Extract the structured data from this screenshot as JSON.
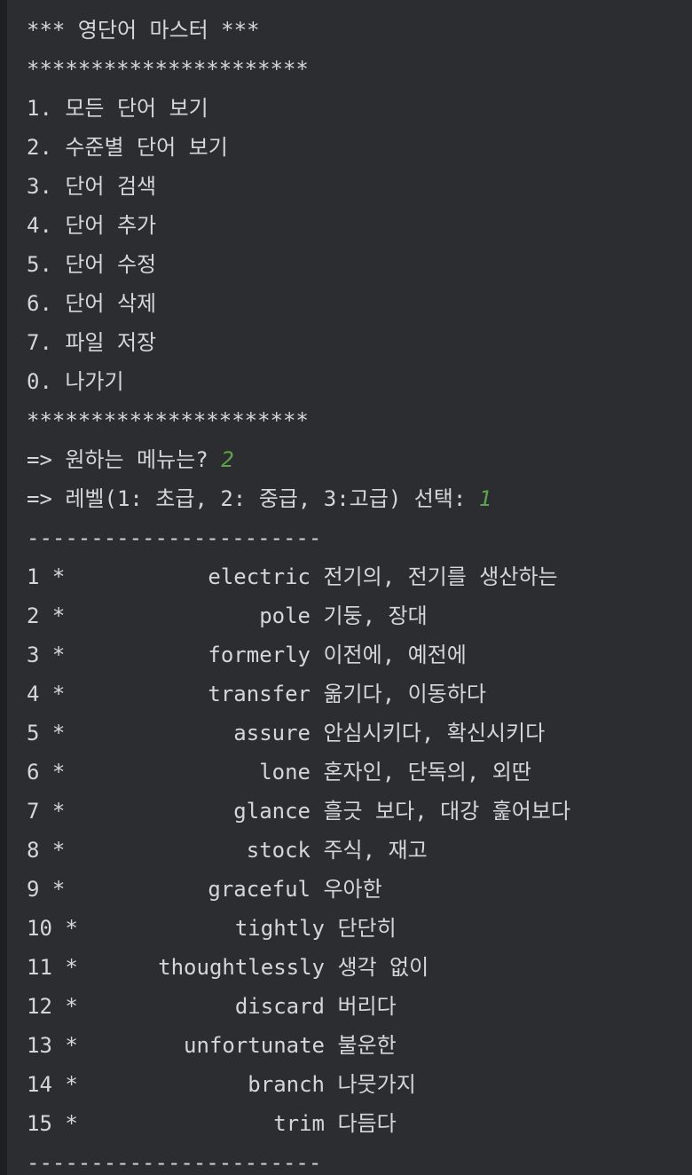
{
  "console": {
    "title": "*** 영단어 마스터 ***",
    "separator_stars": "**********************",
    "menu": [
      "1. 모든 단어 보기",
      "2. 수준별 단어 보기",
      "3. 단어 검색",
      "4. 단어 추가",
      "5. 단어 수정",
      "6. 단어 삭제",
      "7. 파일 저장",
      "0. 나가기"
    ],
    "prompt_menu": "=> 원하는 메뉴는? ",
    "input_menu": "2",
    "prompt_level": "=> 레벨(1: 초급, 2: 중급, 3:고급) 선택: ",
    "input_level": "1",
    "separator_dashes": "-----------------------",
    "words": [
      {
        "num": "1 *",
        "word": "electric",
        "meaning": "전기의, 전기를 생산하는"
      },
      {
        "num": "2 *",
        "word": "pole",
        "meaning": "기둥, 장대"
      },
      {
        "num": "3 *",
        "word": "formerly",
        "meaning": "이전에, 예전에"
      },
      {
        "num": "4 *",
        "word": "transfer",
        "meaning": "옮기다, 이동하다"
      },
      {
        "num": "5 *",
        "word": "assure",
        "meaning": "안심시키다, 확신시키다"
      },
      {
        "num": "6 *",
        "word": "lone",
        "meaning": "혼자인, 단독의, 외딴"
      },
      {
        "num": "7 *",
        "word": "glance",
        "meaning": "흘긋 보다, 대강 훑어보다"
      },
      {
        "num": "8 *",
        "word": "stock",
        "meaning": "주식, 재고"
      },
      {
        "num": "9 *",
        "word": "graceful",
        "meaning": "우아한"
      },
      {
        "num": "10 *",
        "word": "tightly",
        "meaning": "단단히"
      },
      {
        "num": "11 *",
        "word": "thoughtlessly",
        "meaning": "생각 없이"
      },
      {
        "num": "12 *",
        "word": "discard",
        "meaning": "버리다"
      },
      {
        "num": "13 *",
        "word": "unfortunate",
        "meaning": "불운한"
      },
      {
        "num": "14 *",
        "word": "branch",
        "meaning": "나뭇가지"
      },
      {
        "num": "15 *",
        "word": "trim",
        "meaning": "다듬다"
      }
    ]
  }
}
